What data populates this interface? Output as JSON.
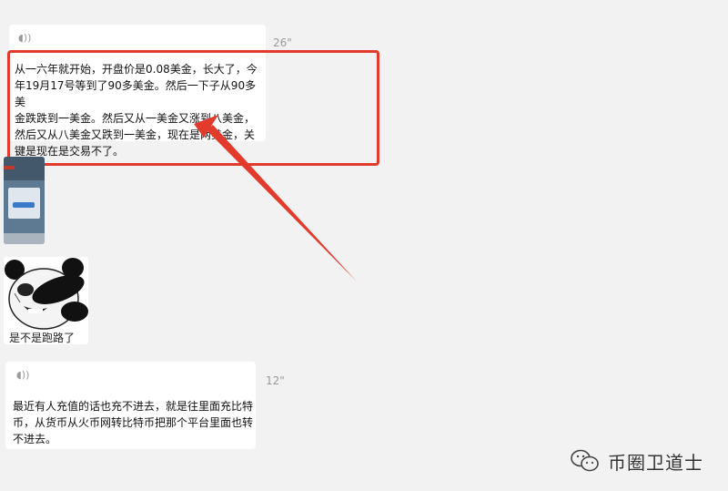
{
  "messages": [
    {
      "type": "voice",
      "icon": "voice-wave-icon",
      "duration": "26\"",
      "text": "从一六年就开始，开盘价是0.08美金，长大了，今年19月17号等到了90多美金。然后一下子从90多美金跌跌到一美金。然后又从一美金又涨到八美金，然后又从八美金又跌到一美金，现在是两美金，关键是现在是交易不了。",
      "lines": [
        "从一六年就开始，开盘价是0.08美金，长大了，今",
        "年19月17号等到了90多美金。然后一下子从90多美",
        "金跌跌到一美金。然后又从一美金又涨到八美金，",
        "然后又从八美金又跌到一美金，现在是两美金，关",
        "键是现在是交易不了。"
      ]
    },
    {
      "type": "image",
      "icon": "app-screenshot-thumbnail"
    },
    {
      "type": "sticker",
      "icon": "panda-sticker-image",
      "caption": "是不是跑路了"
    },
    {
      "type": "voice",
      "icon": "voice-wave-icon",
      "duration": "12\"",
      "lines": [
        "最近有人充值的话也充不进去，就是往里面充比特",
        "币，从货币从火币网转比特币把那个平台里面也转",
        "不进去。"
      ]
    }
  ],
  "annotation": {
    "color": "#e23b2e"
  },
  "watermark": {
    "icon": "wechat-logo-icon",
    "text": "币圈卫道士"
  }
}
